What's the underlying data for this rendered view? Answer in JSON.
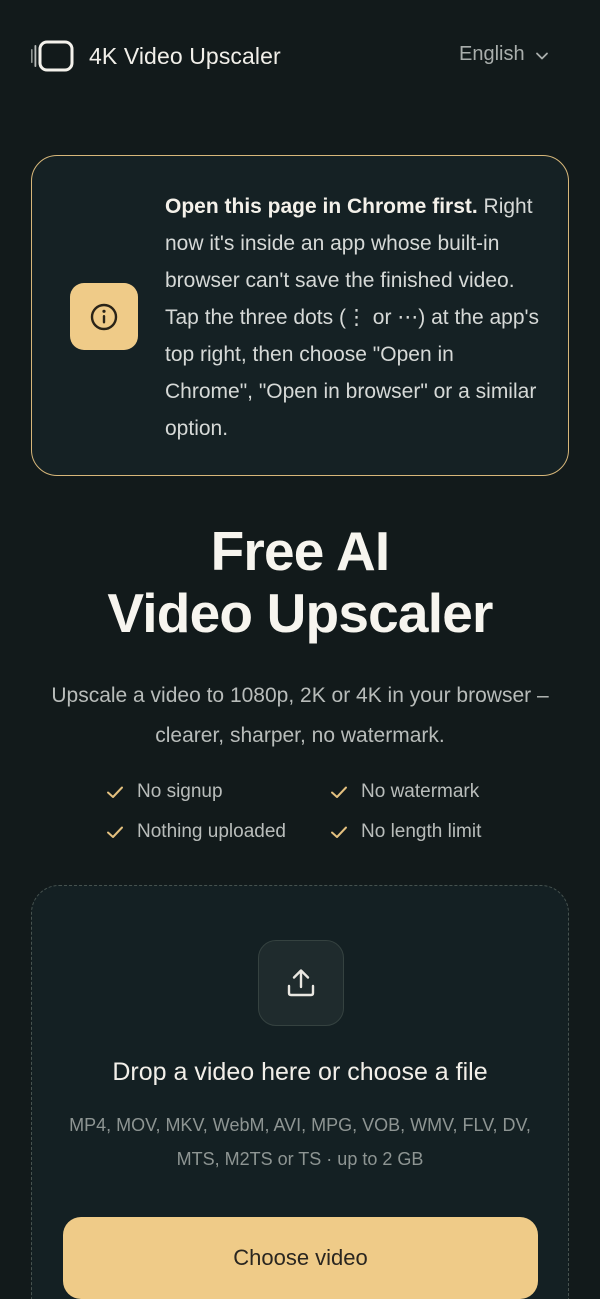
{
  "header": {
    "brand": "4K Video Upscaler",
    "language": "English"
  },
  "notice": {
    "title": "Open this page in Chrome first.",
    "body": "Right now it's inside an app whose built-in browser can't save the finished video. Tap the three dots (⋮ or ⋯) at the app's top right, then choose \"Open in Chrome\", \"Open in browser\" or a similar option."
  },
  "hero": {
    "title_line1": "Free AI",
    "title_line2": "Video Upscaler",
    "subtitle": "Upscale a video to 1080p, 2K or 4K in your browser – clearer, sharper, no watermark."
  },
  "features": [
    "No signup",
    "No watermark",
    "Nothing uploaded",
    "No length limit"
  ],
  "dropzone": {
    "title": "Drop a video here or choose a file",
    "formats": "MP4, MOV, MKV, WebM, AVI, MPG, VOB, WMV, FLV, DV, MTS, M2TS or TS · up to 2 GB",
    "button_label": "Choose video"
  },
  "colors": {
    "background": "#121a1b",
    "accent": "#efcb88",
    "border_accent": "#d7b77a"
  }
}
